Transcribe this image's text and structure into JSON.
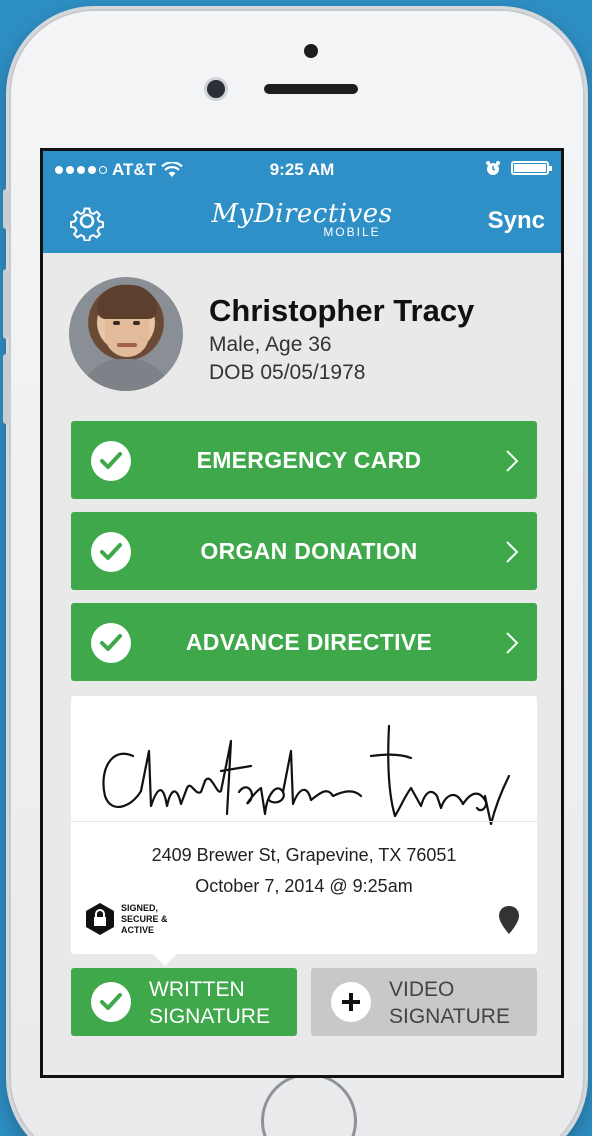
{
  "status_bar": {
    "carrier": "AT&T",
    "time": "9:25 AM"
  },
  "nav": {
    "logo_main": "MyDirectives",
    "logo_sub": "MOBILE",
    "sync_label": "Sync"
  },
  "profile": {
    "name": "Christopher Tracy",
    "gender_age": "Male, Age 36",
    "dob": "DOB 05/05/1978"
  },
  "actions": [
    {
      "label": "EMERGENCY CARD"
    },
    {
      "label": "ORGAN DONATION"
    },
    {
      "label": "ADVANCE DIRECTIVE"
    }
  ],
  "signature_card": {
    "address": "2409 Brewer St, Grapevine, TX  76051",
    "date": "October 7, 2014 @ 9:25am",
    "badge": "SIGNED, SECURE & ACTIVE"
  },
  "signature_buttons": {
    "written_line1": "WRITTEN",
    "written_line2": "SIGNATURE",
    "video_line1": "VIDEO",
    "video_line2": "SIGNATURE"
  },
  "colors": {
    "background": "#2e8fc4",
    "nav_blue": "#2f8fc7",
    "action_green": "#3ea84a",
    "inactive_gray": "#c8c8c9"
  }
}
